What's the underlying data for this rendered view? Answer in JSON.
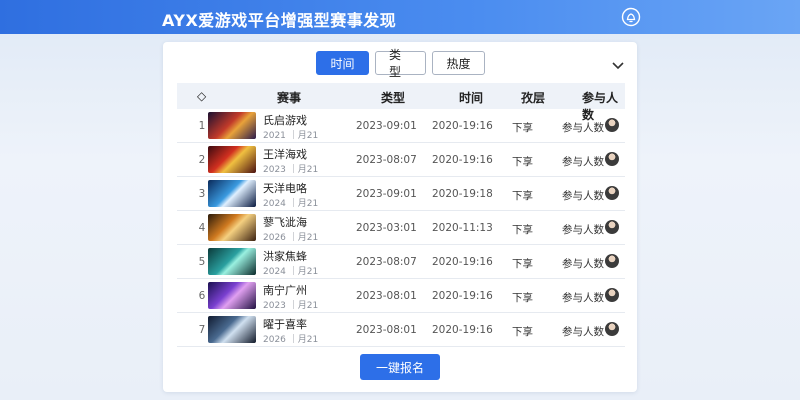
{
  "header": {
    "title": "AYX爱游戏平台增强型赛事发现",
    "bell_icon": "bell-icon"
  },
  "tabs": [
    {
      "label": "时间",
      "active": true
    },
    {
      "label": "类型",
      "active": false
    },
    {
      "label": "热度",
      "active": false
    }
  ],
  "table": {
    "columns": [
      "◇",
      "赛事",
      "类型",
      "时间",
      "孜层",
      "参与人数"
    ],
    "rows": [
      {
        "idx": "1",
        "name": "氏启游戏",
        "sub": "2021 ｜月21",
        "type": "2023-09:01",
        "time": "2020-19:16",
        "level": "下享",
        "join": "参与人数"
      },
      {
        "idx": "2",
        "name": "王洋海戏",
        "sub": "2023 ｜月21",
        "type": "2023-08:07",
        "time": "2020-19:16",
        "level": "下享",
        "join": "参与人数"
      },
      {
        "idx": "3",
        "name": "天洋电咯",
        "sub": "2024 ｜月21",
        "type": "2023-09:01",
        "time": "2020-19:18",
        "level": "下享",
        "join": "参与人数"
      },
      {
        "idx": "4",
        "name": "蓼飞泚海",
        "sub": "2026 ｜月21",
        "type": "2023-03:01",
        "time": "2020-11:13",
        "level": "下享",
        "join": "参与人数"
      },
      {
        "idx": "5",
        "name": "洪家焦蜂",
        "sub": "2024 ｜月21",
        "type": "2023-08:07",
        "time": "2020-19:16",
        "level": "下享",
        "join": "参与人数"
      },
      {
        "idx": "6",
        "name": "南宁广州",
        "sub": "2023 ｜月21",
        "type": "2023-08:01",
        "time": "2020-19:16",
        "level": "下享",
        "join": "参与人数"
      },
      {
        "idx": "7",
        "name": "曜于喜率",
        "sub": "2026 ｜月21",
        "type": "2023-08:01",
        "time": "2020-19:16",
        "level": "下享",
        "join": "参与人数"
      }
    ]
  },
  "cta": {
    "label": "一键报名"
  },
  "colors": {
    "accent": "#2d6fe8",
    "header_start": "#2f6fe0",
    "header_end": "#6aa5f5"
  }
}
